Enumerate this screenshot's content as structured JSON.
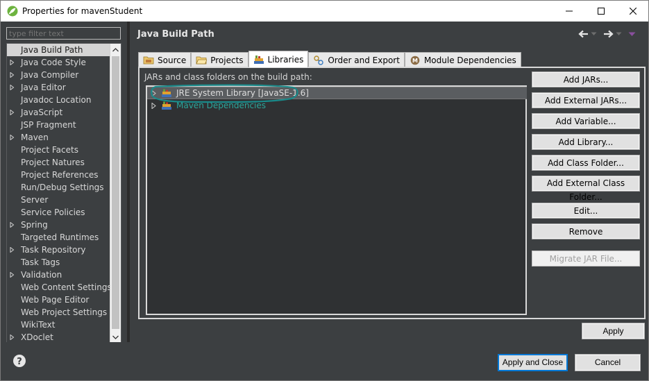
{
  "window": {
    "title": "Properties for mavenStudent",
    "minimize_icon": "minimize-icon",
    "maximize_icon": "maximize-icon",
    "close_icon": "close-icon"
  },
  "filter": {
    "placeholder": "type filter text"
  },
  "nav": {
    "items": [
      {
        "label": "Java Build Path",
        "expandable": false,
        "selected": true
      },
      {
        "label": "Java Code Style",
        "expandable": true
      },
      {
        "label": "Java Compiler",
        "expandable": true
      },
      {
        "label": "Java Editor",
        "expandable": true
      },
      {
        "label": "Javadoc Location",
        "expandable": false
      },
      {
        "label": "JavaScript",
        "expandable": true
      },
      {
        "label": "JSP Fragment",
        "expandable": false
      },
      {
        "label": "Maven",
        "expandable": true
      },
      {
        "label": "Project Facets",
        "expandable": false
      },
      {
        "label": "Project Natures",
        "expandable": false
      },
      {
        "label": "Project References",
        "expandable": false
      },
      {
        "label": "Run/Debug Settings",
        "expandable": false
      },
      {
        "label": "Server",
        "expandable": false
      },
      {
        "label": "Service Policies",
        "expandable": false
      },
      {
        "label": "Spring",
        "expandable": true
      },
      {
        "label": "Targeted Runtimes",
        "expandable": false
      },
      {
        "label": "Task Repository",
        "expandable": true
      },
      {
        "label": "Task Tags",
        "expandable": false
      },
      {
        "label": "Validation",
        "expandable": true
      },
      {
        "label": "Web Content Settings",
        "expandable": false
      },
      {
        "label": "Web Page Editor",
        "expandable": false
      },
      {
        "label": "Web Project Settings",
        "expandable": false
      },
      {
        "label": "WikiText",
        "expandable": false
      },
      {
        "label": "XDoclet",
        "expandable": true
      }
    ]
  },
  "page": {
    "title": "Java Build Path"
  },
  "tabs": [
    {
      "label": "Source",
      "icon": "source-folder-icon",
      "active": false
    },
    {
      "label": "Projects",
      "icon": "projects-folder-icon",
      "active": false
    },
    {
      "label": "Libraries",
      "icon": "libraries-icon",
      "active": true
    },
    {
      "label": "Order and Export",
      "icon": "order-export-icon",
      "active": false
    },
    {
      "label": "Module Dependencies",
      "icon": "module-icon",
      "active": false
    }
  ],
  "libraries": {
    "heading": "JARs and class folders on the build path:",
    "entries": [
      {
        "label": "JRE System Library [JavaSE-1.6]",
        "selected": true
      },
      {
        "label": "Maven Dependencies",
        "selected": false
      }
    ]
  },
  "buttons": [
    {
      "label": "Add JARs...",
      "name": "add-jars-button",
      "enabled": true
    },
    {
      "label": "Add External JARs...",
      "name": "add-external-jars-button",
      "enabled": true
    },
    {
      "label": "Add Variable...",
      "name": "add-variable-button",
      "enabled": true
    },
    {
      "label": "Add Library...",
      "name": "add-library-button",
      "enabled": true
    },
    {
      "label": "Add Class Folder...",
      "name": "add-class-folder-button",
      "enabled": true
    },
    {
      "label": "Add External Class Folder...",
      "name": "add-external-class-folder-button",
      "enabled": true
    },
    {
      "label": "Edit...",
      "name": "edit-button",
      "enabled": true
    },
    {
      "label": "Remove",
      "name": "remove-button",
      "enabled": true
    },
    {
      "label": "Migrate JAR File...",
      "name": "migrate-jar-button",
      "enabled": false
    }
  ],
  "footer": {
    "apply": "Apply",
    "apply_and_close": "Apply and Close",
    "cancel": "Cancel"
  },
  "colors": {
    "panel_bg": "#3c3f41",
    "annotation": "#1a8a8a",
    "maven_text": "#2aa69b",
    "focus_border": "#0078d7"
  }
}
